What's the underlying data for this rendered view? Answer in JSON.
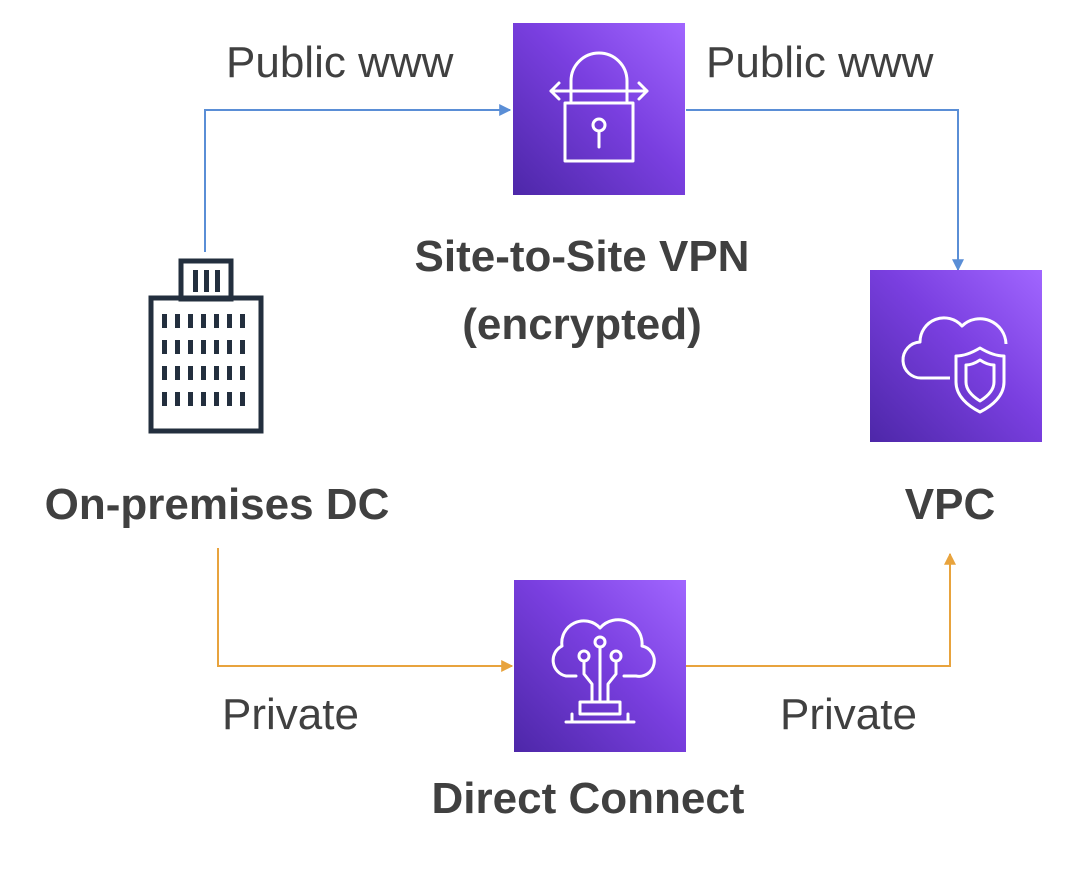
{
  "nodes": {
    "vpn": {
      "title_line1": "Site-to-Site VPN",
      "title_line2": "(encrypted)",
      "icon": "vpn-lock-icon"
    },
    "onprem": {
      "title": "On-premises DC",
      "icon": "office-building-icon"
    },
    "vpc": {
      "title": "VPC",
      "icon": "cloud-shield-icon"
    },
    "direct_connect": {
      "title": "Direct Connect",
      "icon": "cloud-circuit-icon"
    }
  },
  "links": {
    "top_left_label": "Public www",
    "top_right_label": "Public www",
    "bottom_left_label": "Private",
    "bottom_right_label": "Private"
  },
  "colors": {
    "public_line": "#5a8ed6",
    "private_line": "#e8a33d",
    "tile_gradient_start": "#4d27a8",
    "tile_gradient_end": "#a166ff",
    "text": "#404040",
    "building_stroke": "#232f3e"
  }
}
